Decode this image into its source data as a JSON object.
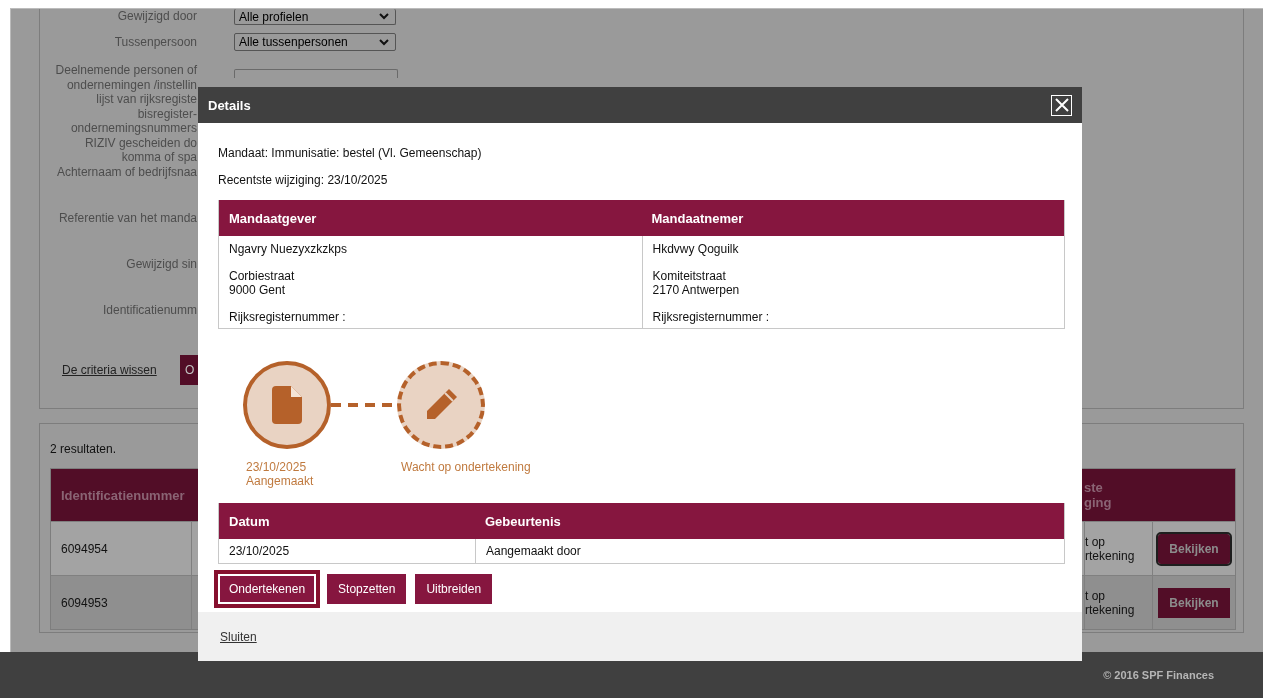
{
  "form": {
    "fields": [
      {
        "kind": "select",
        "label_lines": [
          "Gewijzigd door"
        ],
        "value": "Alle profielen"
      },
      {
        "kind": "select",
        "label_lines": [
          "Tussenpersoon"
        ],
        "value": "Alle tussenpersonen"
      },
      {
        "kind": "input",
        "label_lines": [
          "Deelnemende personen of",
          "ondernemingen /instellin",
          "lijst van rijksregiste",
          "bisregister-",
          "ondernemingsnummers",
          "RIZIV gescheiden do",
          "komma of spa"
        ]
      },
      {
        "kind": "label",
        "label_lines": [
          "Achternaam of bedrijfsnaa"
        ]
      },
      {
        "kind": "label",
        "label_lines": [
          "Referentie van het manda"
        ]
      },
      {
        "kind": "label",
        "label_lines": [
          "Gewijzigd sin"
        ]
      },
      {
        "kind": "label",
        "label_lines": [
          "Identificatienumm"
        ]
      }
    ],
    "clear_link": "De criteria wissen",
    "search_button": "O"
  },
  "results": {
    "count": "2 resultaten.",
    "header": {
      "id": "Identificatienummer",
      "status_lines": [
        "ste",
        "ging"
      ]
    },
    "rows": [
      {
        "id": "6094954",
        "status_lines": [
          "t op",
          "rtekening"
        ],
        "button": "Bekijken",
        "focused": true
      },
      {
        "id": "6094953",
        "status_lines": [
          "t op",
          "rtekening"
        ],
        "button": "Bekijken",
        "focused": false
      }
    ]
  },
  "footer": "© 2016 SPF Finances",
  "dialog": {
    "title": "Details",
    "mandate": "Mandaat: Immunisatie: bestel (Vl. Gemeenschap)",
    "last_change": "Recentste wijziging: 23/10/2025",
    "parties": [
      {
        "heading": "Mandaatgever",
        "name": "Ngavry Nuezyxzkzkps",
        "street": "Corbiestraat",
        "city": "9000 Gent",
        "register": "Rijksregisternummer :"
      },
      {
        "heading": "Mandaatnemer",
        "name": "Hkdvwy Qoguilk",
        "street": "Komiteitstraat",
        "city": "2170 Antwerpen",
        "register": "Rijksregisternummer :"
      }
    ],
    "steps": [
      {
        "kind": "document",
        "done": true,
        "label_lines": [
          "23/10/2025",
          "Aangemaakt"
        ]
      },
      {
        "kind": "pencil",
        "done": false,
        "label_lines": [
          "Wacht op ondertekening"
        ]
      }
    ],
    "events": {
      "columns": [
        "Datum",
        "Gebeurtenis"
      ],
      "rows": [
        [
          "23/10/2025",
          "Aangemaakt door"
        ]
      ]
    },
    "actions": [
      {
        "label": "Ondertekenen",
        "focused": true
      },
      {
        "label": "Stopzetten",
        "focused": false
      },
      {
        "label": "Uitbreiden",
        "focused": false
      }
    ],
    "close_link": "Sluiten"
  }
}
